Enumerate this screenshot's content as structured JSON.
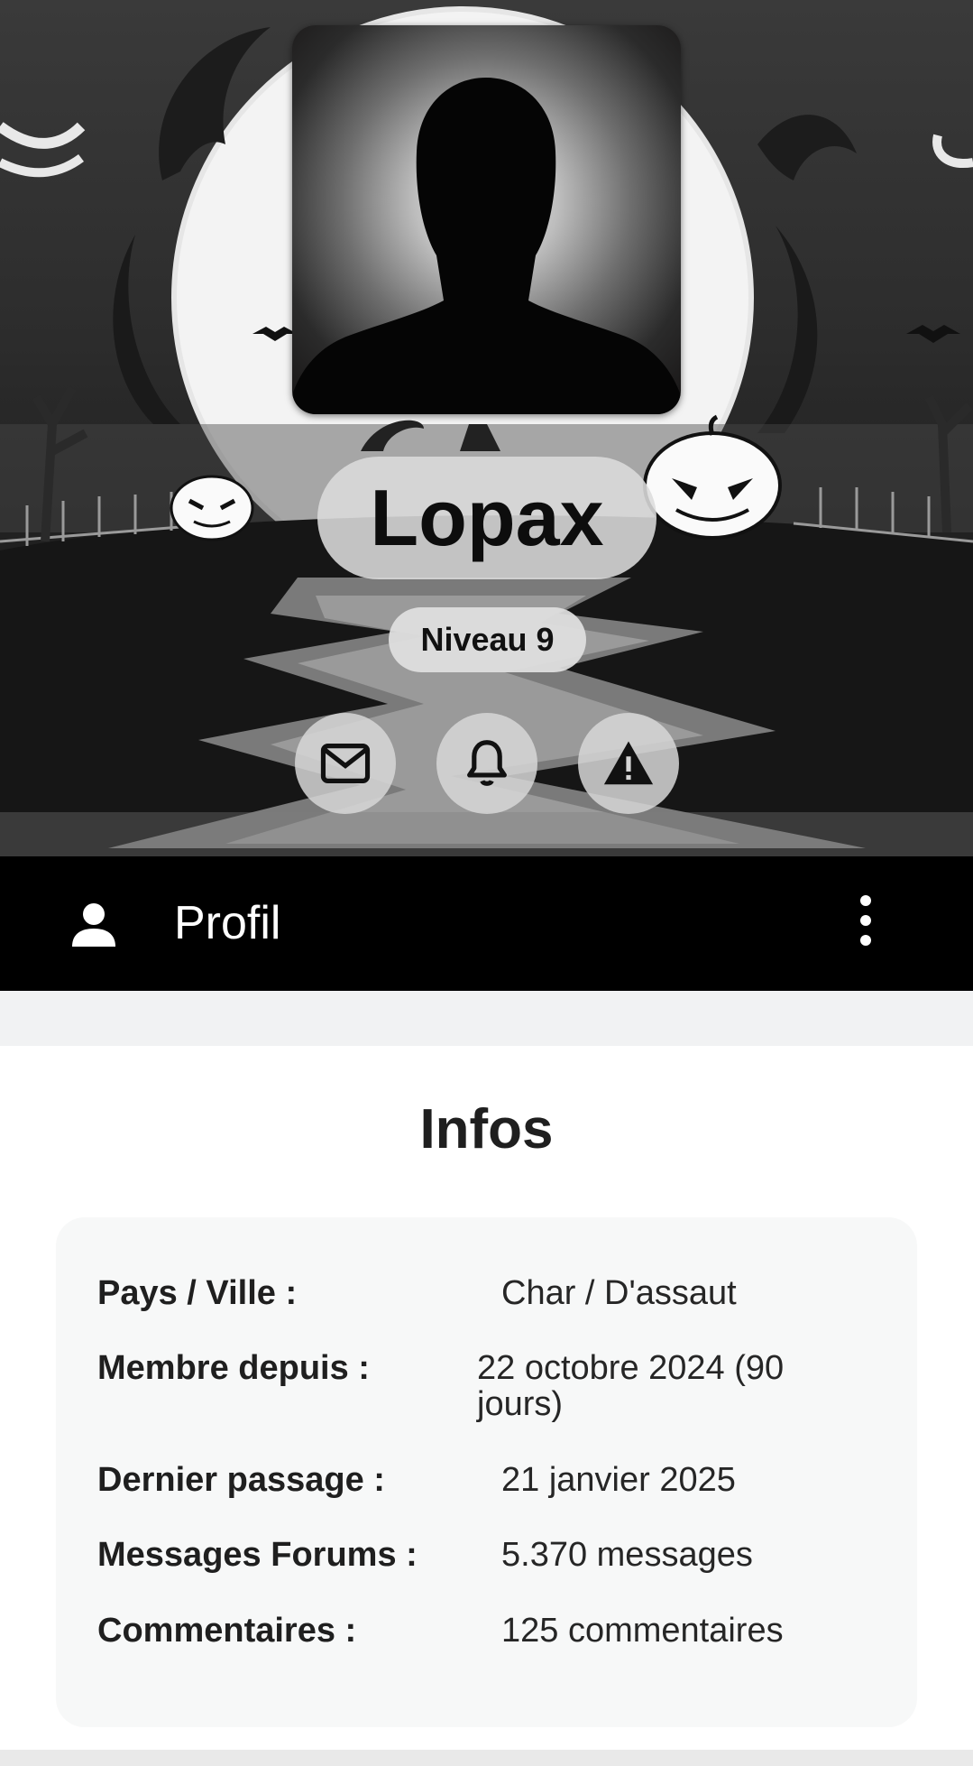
{
  "profile": {
    "username": "Lopax",
    "level": "Niveau 9"
  },
  "actions": [
    {
      "name": "mail-button",
      "icon": "mail-icon"
    },
    {
      "name": "notify-button",
      "icon": "bell-icon"
    },
    {
      "name": "report-button",
      "icon": "warning-icon"
    }
  ],
  "toolbar": {
    "title": "Profil",
    "person_icon": "person-icon",
    "menu_icon": "more-vertical-icon"
  },
  "infos": {
    "title": "Infos",
    "rows": [
      {
        "label": "Pays / Ville :",
        "value": "Char / D'assaut"
      },
      {
        "label": "Membre depuis :",
        "value": "22 octobre 2024 (90 jours)"
      },
      {
        "label": "Dernier passage :",
        "value": "21 janvier 2025"
      },
      {
        "label": "Messages Forums :",
        "value": "5.370 messages"
      },
      {
        "label": "Commentaires :",
        "value": "125 commentaires"
      }
    ]
  },
  "colors": {
    "toolbar_bg": "#000000",
    "card_bg": "#f7f8f8",
    "page_bg": "#f1f2f3"
  }
}
